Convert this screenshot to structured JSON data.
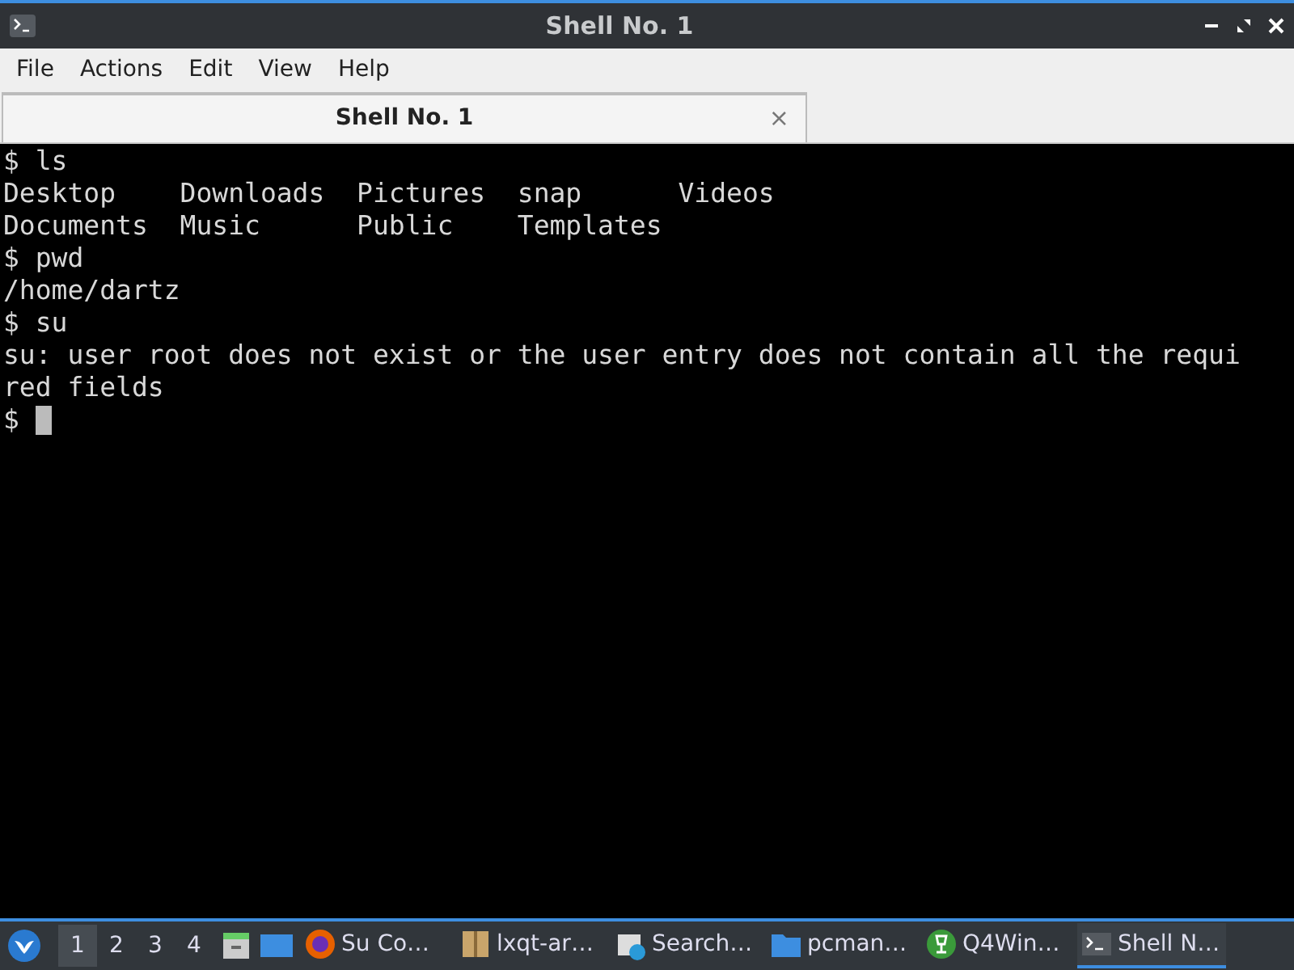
{
  "window": {
    "title": "Shell No. 1"
  },
  "menu": [
    "File",
    "Actions",
    "Edit",
    "View",
    "Help"
  ],
  "tabs": [
    {
      "label": "Shell No. 1",
      "selected": true,
      "close": "×"
    }
  ],
  "terminal": {
    "lines": [
      "$ ls",
      "Desktop    Downloads  Pictures  snap      Videos",
      "Documents  Music      Public    Templates",
      "$ pwd",
      "/home/dartz",
      "$ su",
      "su: user root does not exist or the user entry does not contain all the requi",
      "red fields",
      "$ "
    ],
    "cursor": true
  },
  "taskbar": {
    "desktops": [
      {
        "label": "1",
        "selected": true
      },
      {
        "label": "2",
        "selected": false
      },
      {
        "label": "3",
        "selected": false
      },
      {
        "label": "4",
        "selected": false
      }
    ],
    "tasks": [
      {
        "label": "Su Co…",
        "kind": "browser",
        "selected": false
      },
      {
        "label": "lxqt-ar…",
        "kind": "archive",
        "selected": false
      },
      {
        "label": "Search…",
        "kind": "search",
        "selected": false
      },
      {
        "label": "pcman…",
        "kind": "folder",
        "selected": false
      },
      {
        "label": "Q4Win…",
        "kind": "wine",
        "selected": false
      },
      {
        "label": "Shell N…",
        "kind": "terminal",
        "selected": true
      }
    ]
  }
}
